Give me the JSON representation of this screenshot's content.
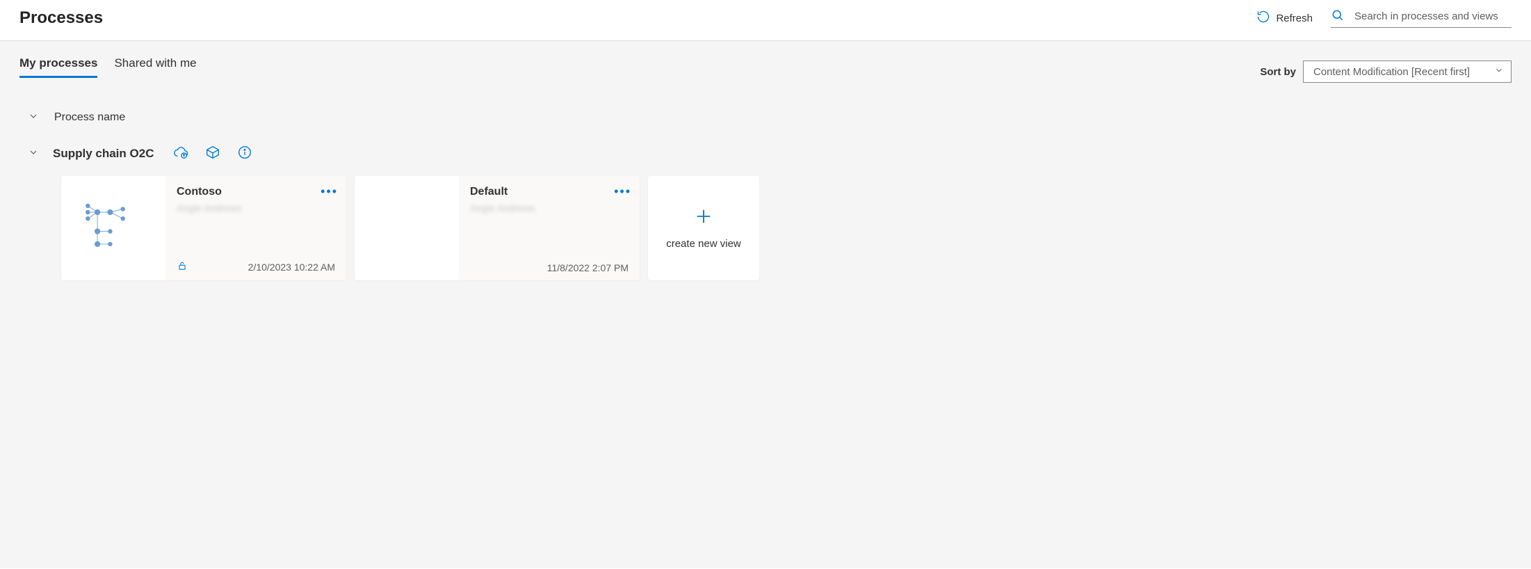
{
  "header": {
    "title": "Processes",
    "refresh_label": "Refresh",
    "search_placeholder": "Search in processes and views"
  },
  "tabs": {
    "my": "My processes",
    "shared": "Shared with me"
  },
  "sort": {
    "label": "Sort by",
    "selected": "Content Modification [Recent first]"
  },
  "section": {
    "column_label": "Process name"
  },
  "process": {
    "name": "Supply chain O2C"
  },
  "cards": [
    {
      "title": "Contoso",
      "owner": "Angie Andrews",
      "timestamp": "2/10/2023 10:22 AM",
      "locked": true
    },
    {
      "title": "Default",
      "owner": "Angie Andrews",
      "timestamp": "11/8/2022 2:07 PM",
      "locked": false
    }
  ],
  "new_view_label": "create new view"
}
